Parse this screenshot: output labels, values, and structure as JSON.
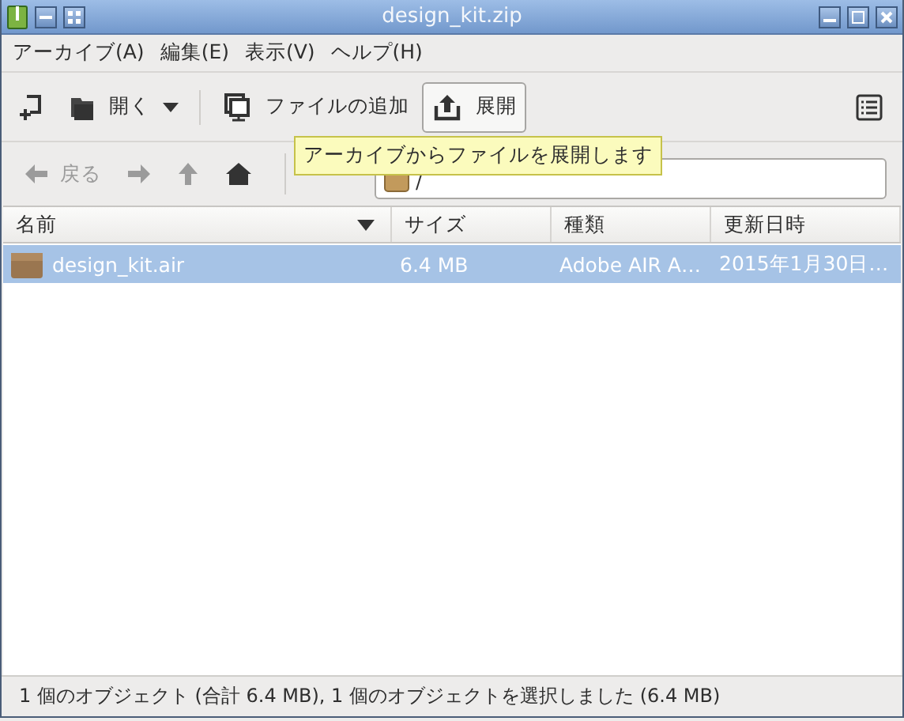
{
  "window": {
    "title": "design_kit.zip"
  },
  "menu": [
    {
      "label": "アーカイブ(A)"
    },
    {
      "label": "編集(E)"
    },
    {
      "label": "表示(V)"
    },
    {
      "label": "ヘルプ(H)"
    }
  ],
  "toolbar": [
    {
      "hovered": false
    },
    {
      "label": "開く",
      "dropdown": true,
      "hovered": false
    },
    {
      "label": "ファイルの追加",
      "hovered": false
    },
    {
      "label": "展開",
      "hovered": true
    }
  ],
  "navigation": [
    {
      "label": "戻る",
      "disabled": true
    },
    {
      "disabled": true
    },
    {
      "disabled": true
    },
    {
      "disabled": false
    }
  ],
  "location": {
    "value": "/"
  },
  "tooltip": {
    "text": "アーカイブからファイルを展開します"
  },
  "columns": [
    {
      "label": "名前",
      "sorted": true
    },
    {
      "label": "サイズ",
      "sorted": false
    },
    {
      "label": "種類",
      "sorted": false
    },
    {
      "label": "更新日時",
      "sorted": false
    }
  ],
  "rows": [
    {
      "cells": [
        "design_kit.air",
        "6.4 MB",
        "Adobe AIR A…",
        "2015年1月30日…"
      ],
      "selected": true
    }
  ],
  "status_bar": {
    "text": "1 個のオブジェクト (合計 6.4 MB), 1 個のオブジェクトを選択しました (6.4 MB)"
  }
}
